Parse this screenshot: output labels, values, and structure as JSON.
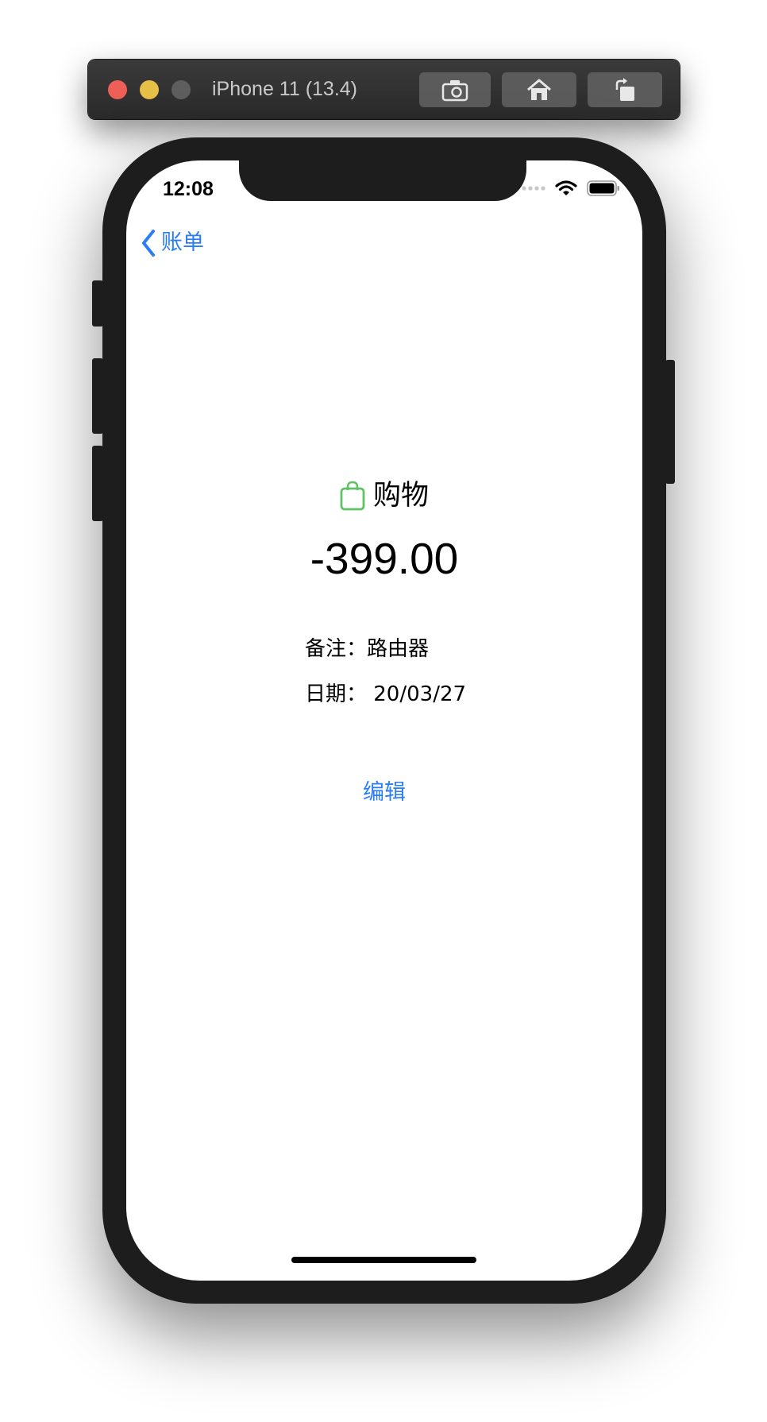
{
  "simulator": {
    "title": "iPhone 11 (13.4)",
    "buttons": [
      "screenshot-icon",
      "home-icon",
      "rotate-icon"
    ]
  },
  "status_bar": {
    "time": "12:08",
    "icons": [
      "cellular-signal-icon",
      "wifi-icon",
      "battery-icon"
    ]
  },
  "nav": {
    "back_label": "账单",
    "back_icon": "chevron-left-icon"
  },
  "detail": {
    "category_icon": "shopping-bag-icon",
    "category_icon_color": "#5fc365",
    "category": "购物",
    "amount": "-399.00",
    "note_label": "备注：",
    "note_value": "路由器",
    "date_label": "日期： ",
    "date_value": "20/03/27"
  },
  "actions": {
    "edit_label": "编辑"
  },
  "colors": {
    "accent": "#2a7ef5"
  }
}
